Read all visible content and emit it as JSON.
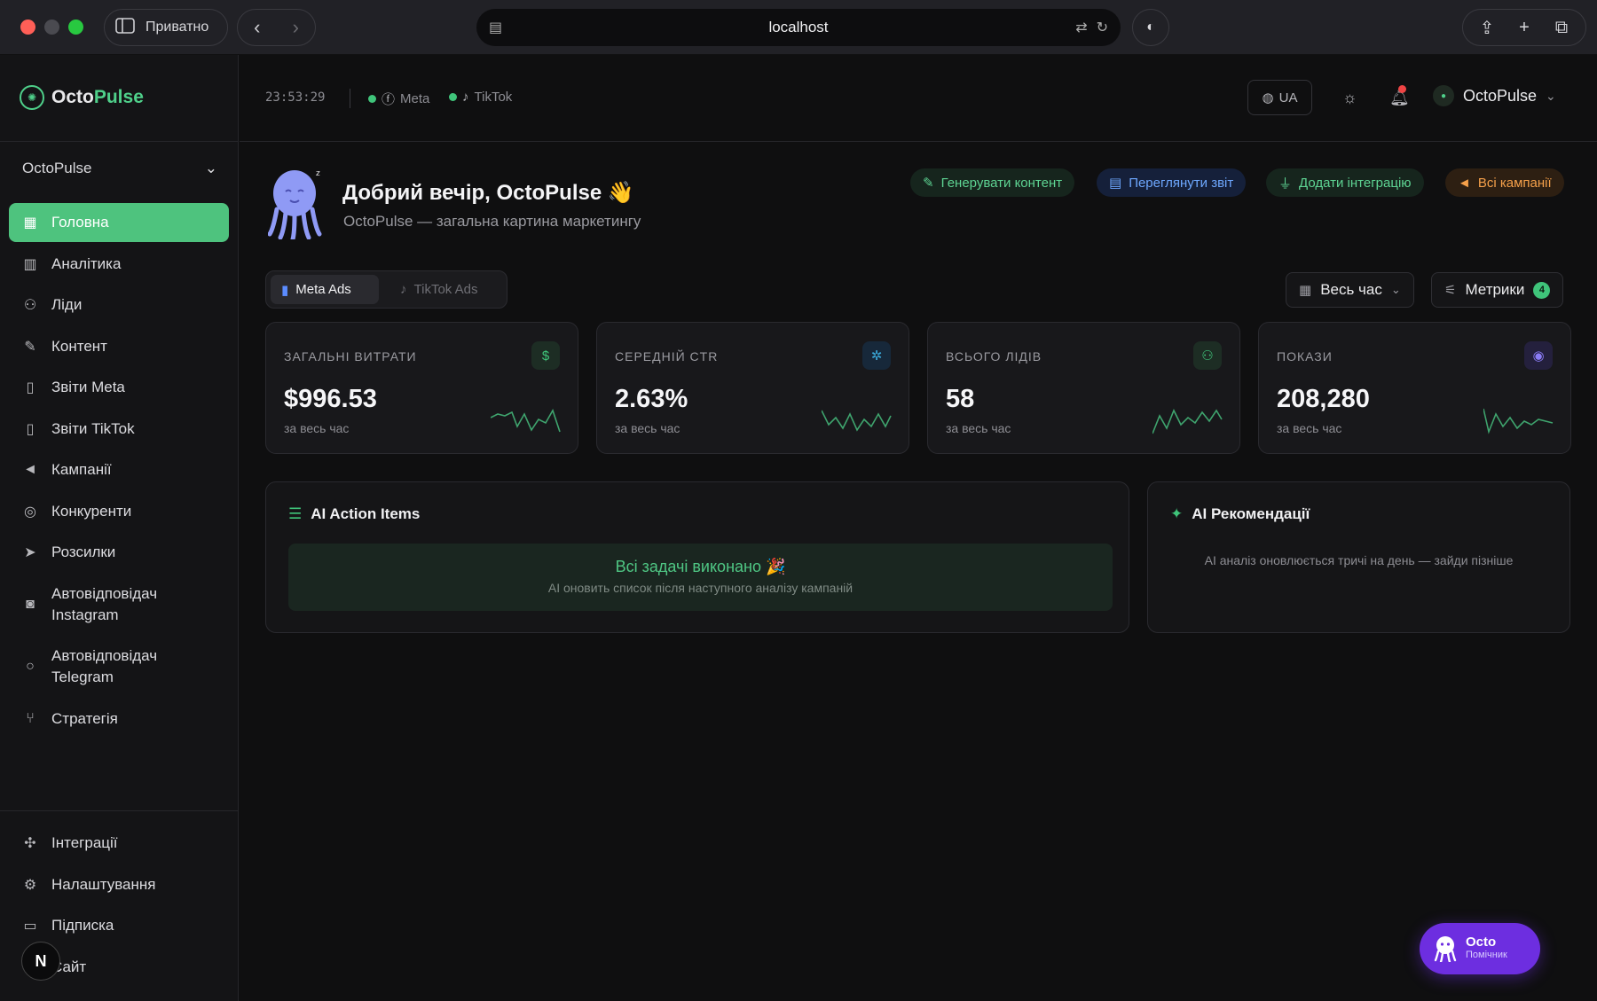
{
  "browser": {
    "private_label": "Приватно",
    "url": "localhost"
  },
  "sidebar": {
    "logo_octo": "Octo",
    "logo_pulse": "Pulse",
    "workspace": "OctoPulse",
    "items": [
      {
        "label": "Головна",
        "icon": "grid-icon"
      },
      {
        "label": "Аналітика",
        "icon": "bar-chart-icon"
      },
      {
        "label": "Ліди",
        "icon": "users-icon"
      },
      {
        "label": "Контент",
        "icon": "pencil-icon"
      },
      {
        "label": "Звіти Meta",
        "icon": "document-icon"
      },
      {
        "label": "Звіти TikTok",
        "icon": "document-icon"
      },
      {
        "label": "Кампанії",
        "icon": "megaphone-icon"
      },
      {
        "label": "Конкуренти",
        "icon": "target-icon"
      },
      {
        "label": "Розсилки",
        "icon": "send-icon"
      },
      {
        "label": "Автовідповідач Instagram",
        "icon": "camera-icon"
      },
      {
        "label": "Автовідповідач Telegram",
        "icon": "chat-icon"
      },
      {
        "label": "Стратегія",
        "icon": "branch-icon"
      }
    ],
    "bottom_items": [
      {
        "label": "Інтеграції",
        "icon": "puzzle-icon"
      },
      {
        "label": "Налаштування",
        "icon": "gear-icon"
      },
      {
        "label": "Підписка",
        "icon": "card-icon"
      },
      {
        "label": "Сайт",
        "icon": "globe-icon"
      }
    ],
    "n_badge": "N"
  },
  "header": {
    "clock": "23:53:29",
    "connections": [
      "Meta",
      "TikTok"
    ],
    "lang": "UA",
    "user": "OctoPulse"
  },
  "greeting": {
    "title": "Добрий вечір, OctoPulse 👋",
    "subtitle": "OctoPulse — загальна картина маркетингу"
  },
  "quick_actions": [
    "Генерувати контент",
    "Переглянути звіт",
    "Додати інтеграцію",
    "Всі кампанії"
  ],
  "tabs": [
    "Meta Ads",
    "TikTok Ads"
  ],
  "filters": {
    "period": "Весь час",
    "metrics": "Метрики",
    "metrics_count": "4"
  },
  "kpis": [
    {
      "label": "ЗАГАЛЬНІ ВИТРАТИ",
      "value": "$996.53",
      "sub": "за весь час",
      "icon": "dollar-icon",
      "color": "#3fc47a"
    },
    {
      "label": "СЕРЕДНІЙ CTR",
      "value": "2.63%",
      "sub": "за весь час",
      "icon": "cursor-click-icon",
      "color": "#3aa8d8"
    },
    {
      "label": "ВСЬОГО ЛІДІВ",
      "value": "58",
      "sub": "за весь час",
      "icon": "users-icon",
      "color": "#3fc47a"
    },
    {
      "label": "ПОКАЗИ",
      "value": "208,280",
      "sub": "за весь час",
      "icon": "eye-icon",
      "color": "#8b7cf6"
    }
  ],
  "panels": {
    "actions_title": "AI Action Items",
    "actions_done": "Всі задачі виконано 🎉",
    "actions_done_sub": "AI оновить список після наступного аналізу кампаній",
    "reco_title": "AI Рекомендації",
    "reco_text": "AI аналіз оновлюється тричі на день — зайди пізніше"
  },
  "assistant": {
    "name": "Octo",
    "role": "Помічник"
  }
}
